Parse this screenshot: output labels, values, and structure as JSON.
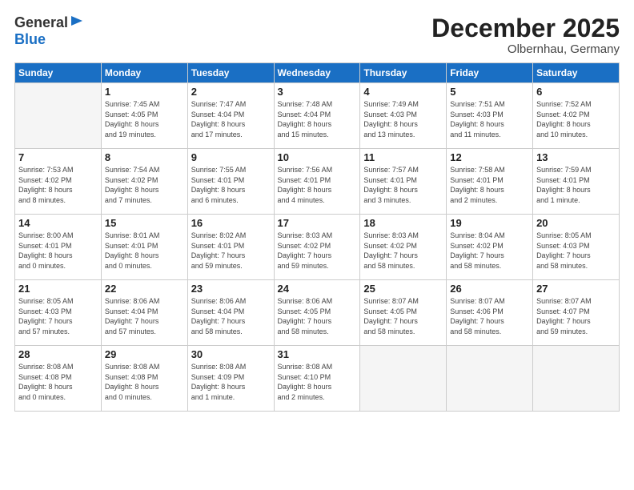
{
  "logo": {
    "general": "General",
    "blue": "Blue"
  },
  "title": "December 2025",
  "location": "Olbernhau, Germany",
  "days_header": [
    "Sunday",
    "Monday",
    "Tuesday",
    "Wednesday",
    "Thursday",
    "Friday",
    "Saturday"
  ],
  "weeks": [
    [
      {
        "day": "",
        "info": ""
      },
      {
        "day": "1",
        "info": "Sunrise: 7:45 AM\nSunset: 4:05 PM\nDaylight: 8 hours\nand 19 minutes."
      },
      {
        "day": "2",
        "info": "Sunrise: 7:47 AM\nSunset: 4:04 PM\nDaylight: 8 hours\nand 17 minutes."
      },
      {
        "day": "3",
        "info": "Sunrise: 7:48 AM\nSunset: 4:04 PM\nDaylight: 8 hours\nand 15 minutes."
      },
      {
        "day": "4",
        "info": "Sunrise: 7:49 AM\nSunset: 4:03 PM\nDaylight: 8 hours\nand 13 minutes."
      },
      {
        "day": "5",
        "info": "Sunrise: 7:51 AM\nSunset: 4:03 PM\nDaylight: 8 hours\nand 11 minutes."
      },
      {
        "day": "6",
        "info": "Sunrise: 7:52 AM\nSunset: 4:02 PM\nDaylight: 8 hours\nand 10 minutes."
      }
    ],
    [
      {
        "day": "7",
        "info": "Sunrise: 7:53 AM\nSunset: 4:02 PM\nDaylight: 8 hours\nand 8 minutes."
      },
      {
        "day": "8",
        "info": "Sunrise: 7:54 AM\nSunset: 4:02 PM\nDaylight: 8 hours\nand 7 minutes."
      },
      {
        "day": "9",
        "info": "Sunrise: 7:55 AM\nSunset: 4:01 PM\nDaylight: 8 hours\nand 6 minutes."
      },
      {
        "day": "10",
        "info": "Sunrise: 7:56 AM\nSunset: 4:01 PM\nDaylight: 8 hours\nand 4 minutes."
      },
      {
        "day": "11",
        "info": "Sunrise: 7:57 AM\nSunset: 4:01 PM\nDaylight: 8 hours\nand 3 minutes."
      },
      {
        "day": "12",
        "info": "Sunrise: 7:58 AM\nSunset: 4:01 PM\nDaylight: 8 hours\nand 2 minutes."
      },
      {
        "day": "13",
        "info": "Sunrise: 7:59 AM\nSunset: 4:01 PM\nDaylight: 8 hours\nand 1 minute."
      }
    ],
    [
      {
        "day": "14",
        "info": "Sunrise: 8:00 AM\nSunset: 4:01 PM\nDaylight: 8 hours\nand 0 minutes."
      },
      {
        "day": "15",
        "info": "Sunrise: 8:01 AM\nSunset: 4:01 PM\nDaylight: 8 hours\nand 0 minutes."
      },
      {
        "day": "16",
        "info": "Sunrise: 8:02 AM\nSunset: 4:01 PM\nDaylight: 7 hours\nand 59 minutes."
      },
      {
        "day": "17",
        "info": "Sunrise: 8:03 AM\nSunset: 4:02 PM\nDaylight: 7 hours\nand 59 minutes."
      },
      {
        "day": "18",
        "info": "Sunrise: 8:03 AM\nSunset: 4:02 PM\nDaylight: 7 hours\nand 58 minutes."
      },
      {
        "day": "19",
        "info": "Sunrise: 8:04 AM\nSunset: 4:02 PM\nDaylight: 7 hours\nand 58 minutes."
      },
      {
        "day": "20",
        "info": "Sunrise: 8:05 AM\nSunset: 4:03 PM\nDaylight: 7 hours\nand 58 minutes."
      }
    ],
    [
      {
        "day": "21",
        "info": "Sunrise: 8:05 AM\nSunset: 4:03 PM\nDaylight: 7 hours\nand 57 minutes."
      },
      {
        "day": "22",
        "info": "Sunrise: 8:06 AM\nSunset: 4:04 PM\nDaylight: 7 hours\nand 57 minutes."
      },
      {
        "day": "23",
        "info": "Sunrise: 8:06 AM\nSunset: 4:04 PM\nDaylight: 7 hours\nand 58 minutes."
      },
      {
        "day": "24",
        "info": "Sunrise: 8:06 AM\nSunset: 4:05 PM\nDaylight: 7 hours\nand 58 minutes."
      },
      {
        "day": "25",
        "info": "Sunrise: 8:07 AM\nSunset: 4:05 PM\nDaylight: 7 hours\nand 58 minutes."
      },
      {
        "day": "26",
        "info": "Sunrise: 8:07 AM\nSunset: 4:06 PM\nDaylight: 7 hours\nand 58 minutes."
      },
      {
        "day": "27",
        "info": "Sunrise: 8:07 AM\nSunset: 4:07 PM\nDaylight: 7 hours\nand 59 minutes."
      }
    ],
    [
      {
        "day": "28",
        "info": "Sunrise: 8:08 AM\nSunset: 4:08 PM\nDaylight: 8 hours\nand 0 minutes."
      },
      {
        "day": "29",
        "info": "Sunrise: 8:08 AM\nSunset: 4:08 PM\nDaylight: 8 hours\nand 0 minutes."
      },
      {
        "day": "30",
        "info": "Sunrise: 8:08 AM\nSunset: 4:09 PM\nDaylight: 8 hours\nand 1 minute."
      },
      {
        "day": "31",
        "info": "Sunrise: 8:08 AM\nSunset: 4:10 PM\nDaylight: 8 hours\nand 2 minutes."
      },
      {
        "day": "",
        "info": ""
      },
      {
        "day": "",
        "info": ""
      },
      {
        "day": "",
        "info": ""
      }
    ]
  ]
}
